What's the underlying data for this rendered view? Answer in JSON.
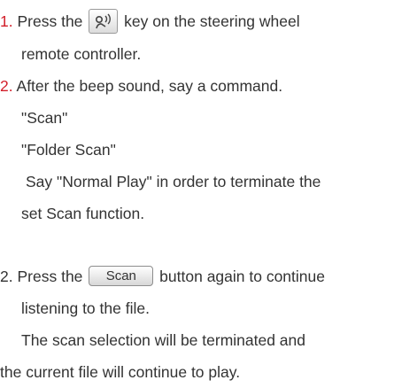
{
  "steps": [
    {
      "number": "1.",
      "before_icon": "Press the",
      "icon": "voice-command-icon",
      "after_icon": "key on the steering wheel",
      "continuation": "remote controller."
    },
    {
      "number": "2.",
      "text": "After the beep sound, say a command.",
      "commands": [
        "\"Scan\"",
        "\"Folder Scan\""
      ],
      "note_line1": "Say \"Normal Play\" in order to terminate the",
      "note_line2": "set Scan function."
    }
  ],
  "section2": {
    "number": "2.",
    "before_button": "Press the",
    "button_label": "Scan",
    "after_button": "button again to continue",
    "line2": "listening to the file.",
    "line3": "The scan selection will be terminated and",
    "line4": "the current file will continue to play."
  },
  "colors": {
    "step_number": "#d21f2a",
    "body_text": "#333333"
  }
}
